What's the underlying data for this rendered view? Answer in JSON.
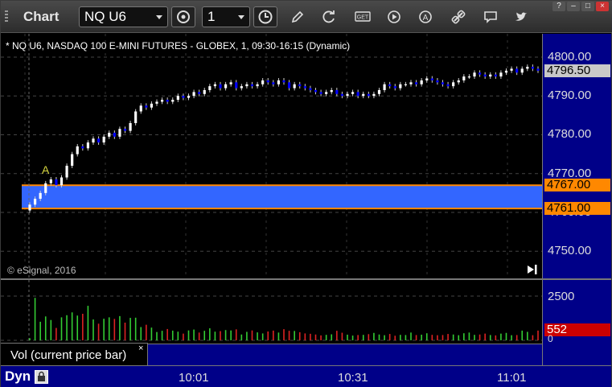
{
  "window": {
    "title": "Chart"
  },
  "toolbar": {
    "symbol": "NQ U6",
    "interval": "1",
    "icons": [
      "cycle-icon",
      "clock-icon",
      "pencil-icon",
      "refresh-icon",
      "get-icon",
      "play-icon",
      "a-icon",
      "link-icon",
      "comment-icon",
      "twitter-icon"
    ]
  },
  "chart": {
    "header": "* NQ U6, NASDAQ 100 E-MINI FUTURES - GLOBEX, 1, 09:30-16:15 (Dynamic)",
    "copyright": "© eSignal, 2016",
    "marker": "A",
    "price_labels": [
      "4800.00",
      "4790.00",
      "4780.00",
      "4770.00",
      "4760.00",
      "4750.00"
    ],
    "last_price": "4796.50",
    "level_high": "4767.00",
    "level_low": "4761.00",
    "colors": {
      "up": "#ffffff",
      "down": "#0000ff",
      "zone": "#3366ff",
      "level": "#ff8800",
      "scale_bg": "#000088"
    }
  },
  "volume": {
    "legend": "Vol (current price bar)",
    "close_label": "×",
    "scale_label": "2500",
    "zero_label": "0",
    "current_value": "552"
  },
  "time_axis": {
    "mode_label": "Dyn",
    "labels": [
      "10:01",
      "10:31",
      "11:01"
    ]
  },
  "chart_data": {
    "type": "candlestick",
    "x_start": "09:30",
    "y_range": [
      4743,
      4806
    ],
    "close": [
      4762.0,
      4763.5,
      4765.0,
      4767.5,
      4768.5,
      4767.0,
      4769.0,
      4772.0,
      4775.0,
      4777.0,
      4776.5,
      4778.0,
      4779.0,
      4778.0,
      4779.5,
      4780.5,
      4779.5,
      4781.5,
      4781.0,
      4783.0,
      4786.0,
      4787.5,
      4787.0,
      4788.0,
      4788.5,
      4789.0,
      4788.5,
      4789.0,
      4790.0,
      4789.5,
      4790.0,
      4791.0,
      4790.5,
      4791.5,
      4792.5,
      4793.0,
      4792.0,
      4793.0,
      4793.5,
      4792.0,
      4792.5,
      4793.0,
      4792.5,
      4793.0,
      4794.0,
      4793.5,
      4793.0,
      4794.0,
      4793.5,
      4792.0,
      4793.0,
      4792.5,
      4792.0,
      4791.5,
      4791.0,
      4790.5,
      4791.0,
      4791.5,
      4790.5,
      4790.0,
      4790.5,
      4791.0,
      4790.0,
      4790.5,
      4790.0,
      4790.5,
      4791.5,
      4793.0,
      4792.5,
      4792.0,
      4793.0,
      4793.0,
      4793.5,
      4793.0,
      4794.0,
      4794.5,
      4794.0,
      4793.5,
      4793.0,
      4792.5,
      4793.5,
      4794.0,
      4795.0,
      4795.0,
      4796.0,
      4795.5,
      4795.0,
      4795.5,
      4795.0,
      4796.0,
      4796.5,
      4797.0,
      4796.0,
      4797.0,
      4797.5,
      4797.0,
      4796.5
    ],
    "volume": [
      120,
      2400,
      1050,
      1350,
      1150,
      700,
      1300,
      1420,
      1580,
      1400,
      1500,
      1950,
      1180,
      940,
      1220,
      1300,
      1210,
      1370,
      1000,
      1270,
      1280,
      750,
      880,
      720,
      470,
      540,
      640,
      550,
      490,
      380,
      560,
      610,
      440,
      540,
      680,
      490,
      520,
      580,
      560,
      620,
      330,
      480,
      560,
      450,
      390,
      500,
      550,
      440,
      630,
      540,
      530,
      460,
      390,
      370,
      330,
      280,
      310,
      340,
      540,
      430,
      320,
      270,
      300,
      310,
      350,
      420,
      330,
      290,
      360,
      260,
      310,
      300,
      440,
      300,
      320,
      400,
      310,
      290,
      300,
      360,
      330,
      290,
      400,
      440,
      310,
      330,
      380,
      300,
      280,
      380,
      420,
      290,
      300,
      550,
      480,
      290,
      552
    ],
    "levels": [
      4767.0,
      4761.0
    ],
    "volume_axis": {
      "labels": [
        "2500",
        "0"
      ]
    },
    "x_ticks": [
      "10:01",
      "10:31",
      "11:01"
    ]
  }
}
